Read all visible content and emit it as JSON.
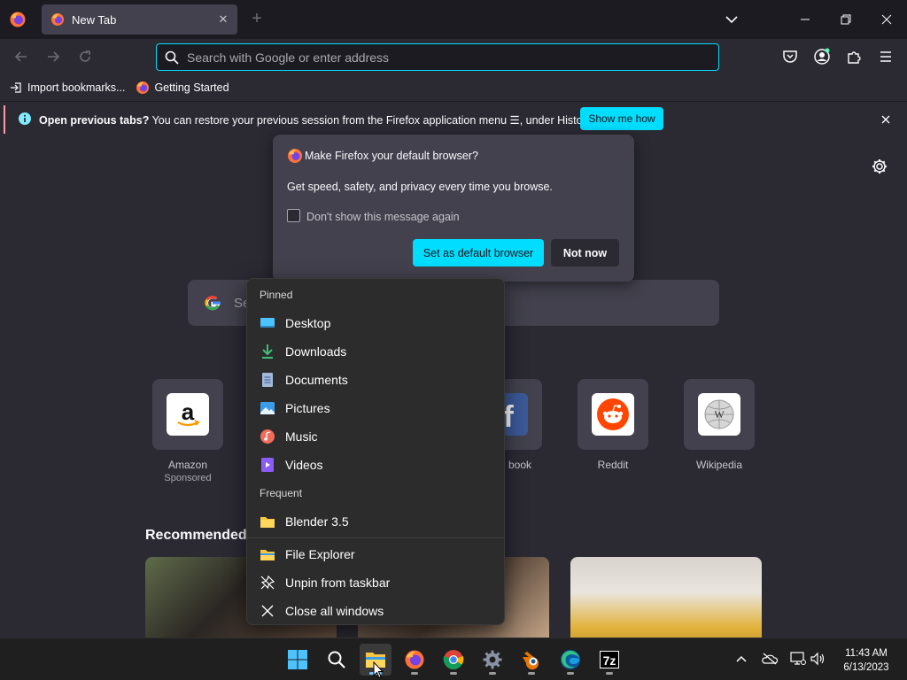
{
  "tabstrip": {
    "tab_title": "New Tab",
    "new_tab": "+"
  },
  "navbar": {
    "url_placeholder": "Search with Google or enter address"
  },
  "bookmarks": [
    {
      "label": "Import bookmarks...",
      "icon": "import-icon"
    },
    {
      "label": "Getting Started",
      "icon": "firefox-icon"
    }
  ],
  "notification": {
    "lead": "Open previous tabs?",
    "text": " You can restore your previous session from the Firefox application menu ☰, under History.",
    "button": "Show me how",
    "accent": "#ff9aa2"
  },
  "popup": {
    "title": "Make Firefox your default browser?",
    "body": "Get speed, safety, and privacy every time you browse.",
    "checkbox_label": "Don't show this message again",
    "checkbox_checked": false,
    "primary": "Set as default browser",
    "secondary": "Not now",
    "accent": "#00ddff"
  },
  "newtab": {
    "search_placeholder": "Se",
    "recommended_label": "Recommended",
    "top_sites": [
      {
        "label": "Amazon",
        "sponsor": "Sponsored",
        "icon": "amazon-icon"
      },
      {
        "label": "book",
        "sponsor": "",
        "icon": "facebook-icon"
      },
      {
        "label": "Reddit",
        "sponsor": "",
        "icon": "reddit-icon"
      },
      {
        "label": "Wikipedia",
        "sponsor": "",
        "icon": "wikipedia-icon"
      }
    ]
  },
  "jumplist": {
    "pinned_header": "Pinned",
    "pinned": [
      {
        "label": "Desktop",
        "icon": "desktop-folder-icon"
      },
      {
        "label": "Downloads",
        "icon": "downloads-icon"
      },
      {
        "label": "Documents",
        "icon": "documents-icon"
      },
      {
        "label": "Pictures",
        "icon": "pictures-icon"
      },
      {
        "label": "Music",
        "icon": "music-icon"
      },
      {
        "label": "Videos",
        "icon": "videos-icon"
      }
    ],
    "frequent_header": "Frequent",
    "frequent": [
      {
        "label": "Blender 3.5",
        "icon": "folder-icon"
      }
    ],
    "actions": [
      {
        "label": "File Explorer",
        "icon": "file-explorer-icon"
      },
      {
        "label": "Unpin from taskbar",
        "icon": "unpin-icon"
      },
      {
        "label": "Close all windows",
        "icon": "close-icon"
      }
    ]
  },
  "taskbar": {
    "apps": [
      "start",
      "search",
      "file-explorer",
      "firefox",
      "chrome",
      "settings",
      "blender",
      "edge",
      "7zip"
    ],
    "time": "11:43 AM",
    "date": "6/13/2023"
  }
}
